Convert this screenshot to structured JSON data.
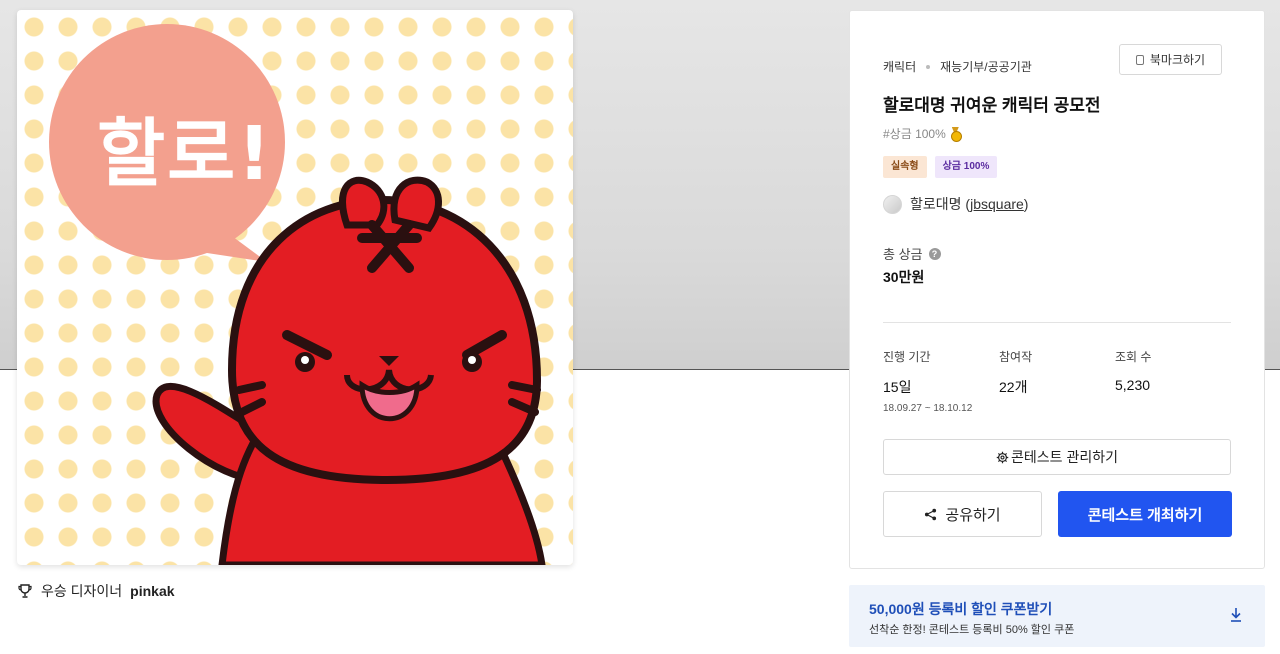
{
  "artwork": {
    "bubble_text": "할로!"
  },
  "winner": {
    "prefix": "우승 디자이너",
    "name": "pinkak"
  },
  "card": {
    "breadcrumb": [
      "캐릭터",
      "재능기부/공공기관"
    ],
    "bookmark_label": "북마크하기",
    "title": "할로대명 귀여운 캐릭터 공모전",
    "hashtag": "#상금 100%",
    "badges": [
      "실속형",
      "상금 100%"
    ],
    "host_name": "할로대명",
    "host_handle": "jbsquare",
    "total_prize_label": "총 상금",
    "total_prize_value": "30만원",
    "stats": [
      {
        "label": "진행 기간",
        "value": "15일",
        "range_start": "18.09.27",
        "range_sep": "~",
        "range_end": "18.10.12"
      },
      {
        "label": "참여작",
        "value": "22개"
      },
      {
        "label": "조회 수",
        "value": "5,230"
      }
    ],
    "manage_label": "콘테스트 관리하기",
    "share_label": "공유하기",
    "host_contest_label": "콘테스트 개최하기"
  },
  "coupon": {
    "title": "50,000원 등록비 할인 쿠폰받기",
    "subtitle": "선착순 한정! 콘테스트 등록비 50% 할인 쿠폰"
  },
  "colors": {
    "primary": "#2155f0",
    "coupon_text": "#1f4fb8",
    "character_red": "#e31d23",
    "bubble": "#f3a08e"
  },
  "icons": {
    "bookmark": "bookmark-icon",
    "medal": "medal-icon",
    "help": "help-icon",
    "gear": "gear-icon",
    "share": "share-icon",
    "trophy": "trophy-icon",
    "download": "download-icon"
  }
}
